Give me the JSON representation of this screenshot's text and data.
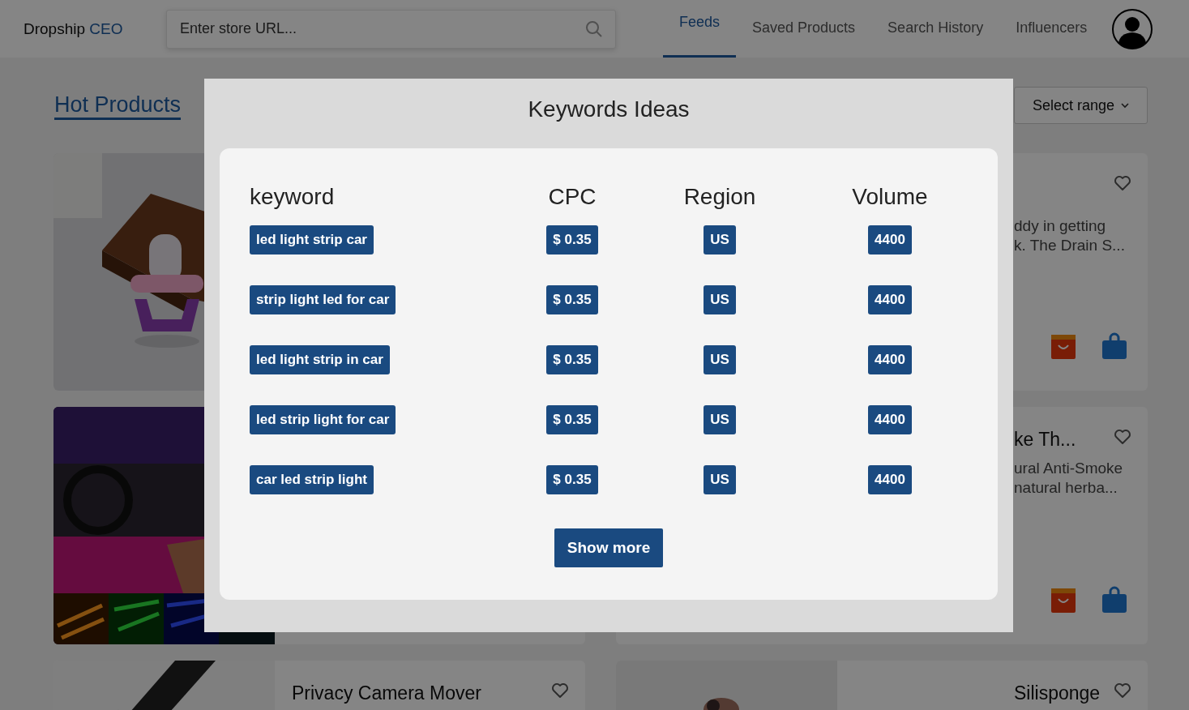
{
  "header": {
    "brand": "Dropship",
    "brand_accent": "CEO",
    "search": {
      "placeholder": "Enter store URL..."
    },
    "nav": [
      {
        "label": "Feeds",
        "selected": true
      },
      {
        "label": "Saved Products",
        "selected": false
      },
      {
        "label": "Search History",
        "selected": false
      },
      {
        "label": "Influencers",
        "selected": false
      }
    ]
  },
  "page": {
    "title": "Hot Products",
    "range_select": "Select range"
  },
  "cards": [
    {
      "image": {
        "kind": "picture"
      }
    },
    {
      "description": [
        "ddy in getting",
        "k. The Drain S..."
      ]
    },
    {
      "image": {
        "kind": "picture"
      }
    },
    {
      "title": "ke Th...",
      "description": [
        "ural Anti-Smoke",
        "natural herba..."
      ]
    },
    {
      "image": {
        "kind": "picture"
      },
      "title": "Privacy Camera Mover"
    },
    {
      "image": {
        "kind": "picture"
      },
      "title": "Silisponge"
    }
  ],
  "modal": {
    "title": "Keywords Ideas",
    "columns": [
      "keyword",
      "CPC",
      "Region",
      "Volume"
    ],
    "rows": [
      {
        "keyword": "led light strip car",
        "cpc": "$ 0.35",
        "region": "US",
        "volume": "4400"
      },
      {
        "keyword": "strip light led for car",
        "cpc": "$ 0.35",
        "region": "US",
        "volume": "4400"
      },
      {
        "keyword": "led light strip in car",
        "cpc": "$ 0.35",
        "region": "US",
        "volume": "4400"
      },
      {
        "keyword": "led strip light for car",
        "cpc": "$ 0.35",
        "region": "US",
        "volume": "4400"
      },
      {
        "keyword": "car led strip light",
        "cpc": "$ 0.35",
        "region": "US",
        "volume": "4400"
      }
    ],
    "button": "Show more"
  }
}
